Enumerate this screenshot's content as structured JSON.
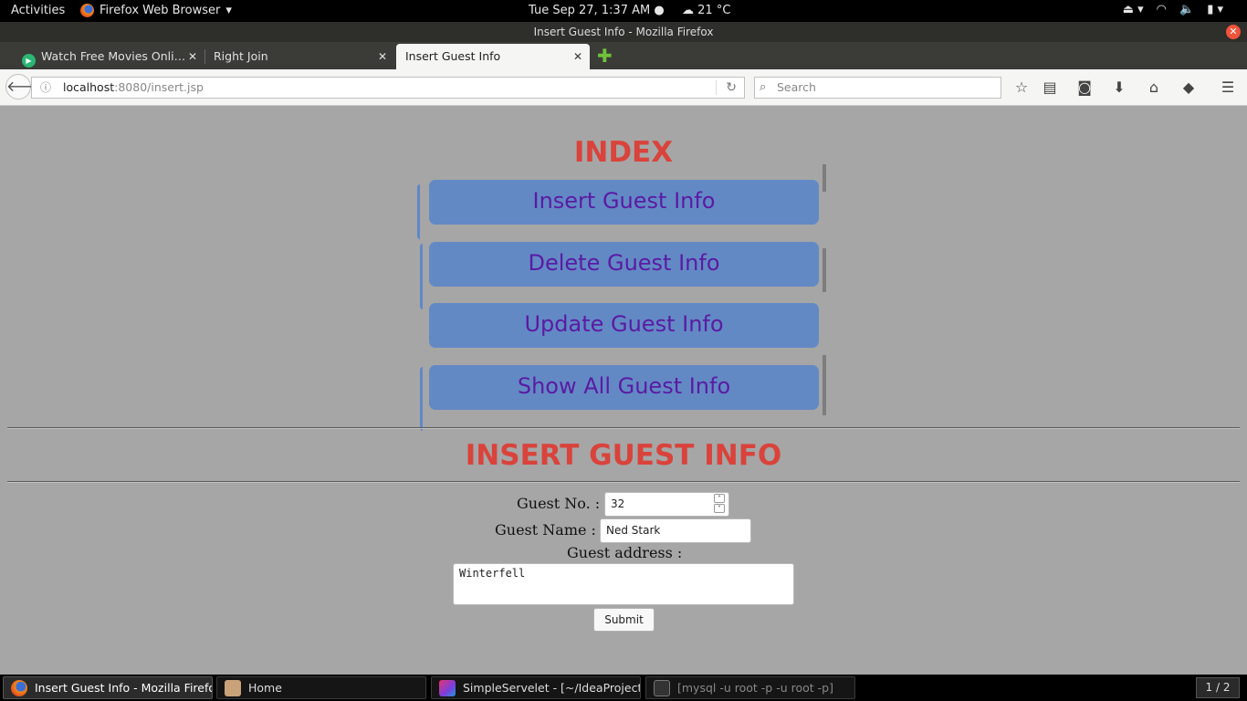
{
  "topbar": {
    "activities": "Activities",
    "app_name": "Firefox Web Browser",
    "clock": "Tue Sep 27,  1:37 AM",
    "weather": "21 °C"
  },
  "window": {
    "title": "Insert Guest Info - Mozilla Firefox"
  },
  "tabs": [
    {
      "label": "Watch Free Movies Onli…"
    },
    {
      "label": "Right Join"
    },
    {
      "label": "Insert Guest Info"
    }
  ],
  "navbar": {
    "url_host": "localhost",
    "url_path": ":8080/insert.jsp",
    "search_placeholder": "Search"
  },
  "page": {
    "index_title": "INDEX",
    "menu": [
      "Insert Guest Info",
      "Delete Guest Info",
      "Update Guest Info",
      "Show All Guest Info"
    ],
    "form_title": "INSERT GUEST INFO",
    "form": {
      "guest_no_label": "Guest No. :",
      "guest_no_value": "32",
      "guest_name_label": "Guest Name :",
      "guest_name_value": "Ned Stark",
      "guest_address_label": "Guest address :",
      "guest_address_value": "Winterfell",
      "submit_label": "Submit"
    }
  },
  "taskbar": {
    "tasks": [
      "Insert Guest Info - Mozilla Firefox",
      "Home",
      "SimpleServelet - [~/IdeaProjects/...",
      "[mysql -u root -p -u root -p]"
    ],
    "workspace": "1 / 2"
  },
  "colors": {
    "page_bg": "#a6a6a6",
    "heading_red": "#d9433b",
    "button_blue": "#6389c5",
    "button_text_purple": "#5a1ba3"
  }
}
